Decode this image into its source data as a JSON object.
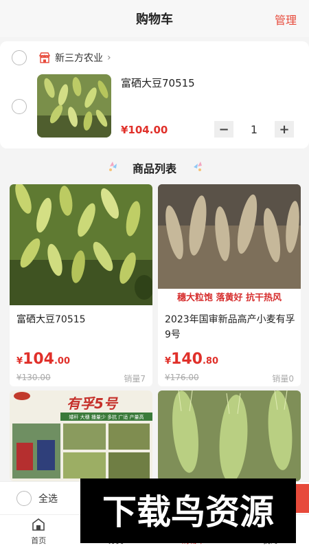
{
  "header": {
    "title": "购物车",
    "manage_label": "管理"
  },
  "cart": {
    "shop_name": "新三方农业",
    "items": [
      {
        "name": "富硒大豆70515",
        "price": "¥104.00",
        "quantity": "1"
      }
    ],
    "minus_label": "−",
    "plus_label": "+"
  },
  "product_list": {
    "title": "商品列表",
    "items": [
      {
        "name": "富硒大豆70515",
        "price_yen": "¥",
        "price_int": "104",
        "price_dec": ".00",
        "original_price": "¥130.00",
        "sales": "销量7"
      },
      {
        "name": "2023年国审新品高产小麦有孚9号",
        "image_text": "穗大粒饱 落黄好 抗干热风",
        "price_yen": "¥",
        "price_int": "140",
        "price_dec": ".80",
        "original_price": "¥176.00",
        "sales": "销量0"
      },
      {
        "name": "",
        "image_title": "有孚5号",
        "image_badge": "矮秆 大穗 播量少 多抗 广适 产量高"
      },
      {
        "name": ""
      }
    ]
  },
  "bottom_bar": {
    "select_all_label": "全选"
  },
  "tabbar": {
    "tabs": [
      {
        "label": "首页",
        "icon": "home-icon"
      },
      {
        "label": "分类",
        "icon": "category-icon"
      },
      {
        "label": "购物车",
        "icon": "cart-icon"
      },
      {
        "label": "我的",
        "icon": "user-icon"
      }
    ]
  },
  "watermark": {
    "text": "下载鸟资源"
  },
  "colors": {
    "accent": "#e0302a",
    "manage": "#e74a3b"
  }
}
